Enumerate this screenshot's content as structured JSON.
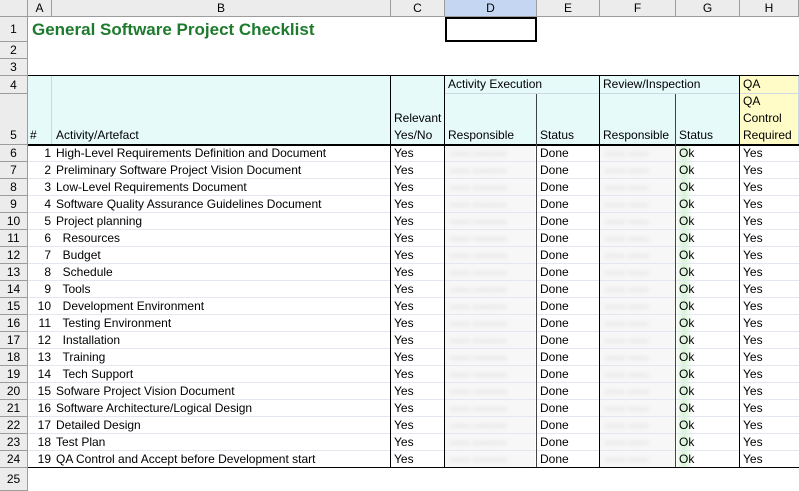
{
  "columns": [
    "A",
    "B",
    "C",
    "D",
    "E",
    "F",
    "G",
    "H"
  ],
  "rows_visible": [
    "1",
    "2",
    "3",
    "4",
    "5",
    "6",
    "7",
    "8",
    "9",
    "10",
    "11",
    "12",
    "13",
    "14",
    "15",
    "16",
    "17",
    "18",
    "19",
    "20",
    "21",
    "22",
    "23",
    "24",
    "25"
  ],
  "title": "General Software Project Checklist",
  "headers": {
    "num": "#",
    "activity": "Activity/Artefact",
    "relevant_line1": "Relevant",
    "relevant_line2": "Yes/No",
    "activity_execution": "Activity Execution",
    "review_inspection": "Review/Inspection",
    "qa": "QA",
    "responsible": "Responsible",
    "status": "Status",
    "qa_line1": "QA",
    "qa_line2": "Control",
    "qa_line3": "Required"
  },
  "items": [
    {
      "row": "6",
      "num": "1",
      "activity": "High-Level Requirements Definition and Document",
      "relevant": "Yes",
      "status": "Done",
      "rev_status": "Ok",
      "qa": "Yes"
    },
    {
      "row": "7",
      "num": "2",
      "activity": "Preliminary Software Project Vision Document",
      "relevant": "Yes",
      "status": "Done",
      "rev_status": "Ok",
      "qa": "Yes"
    },
    {
      "row": "8",
      "num": "3",
      "activity": "Low-Level Requirements Document",
      "relevant": "Yes",
      "status": "Done",
      "rev_status": "Ok",
      "qa": "Yes"
    },
    {
      "row": "9",
      "num": "4",
      "activity": "Software Quality Assurance Guidelines Document",
      "relevant": "Yes",
      "status": "Done",
      "rev_status": "Ok",
      "qa": "Yes"
    },
    {
      "row": "10",
      "num": "5",
      "activity": "Project planning",
      "relevant": "Yes",
      "status": "Done",
      "rev_status": "Ok",
      "qa": "Yes"
    },
    {
      "row": "11",
      "num": "6",
      "activity": "  Resources",
      "relevant": "Yes",
      "status": "Done",
      "rev_status": "Ok",
      "qa": "Yes"
    },
    {
      "row": "12",
      "num": "7",
      "activity": "  Budget",
      "relevant": "Yes",
      "status": "Done",
      "rev_status": "Ok",
      "qa": "Yes"
    },
    {
      "row": "13",
      "num": "8",
      "activity": "  Schedule",
      "relevant": "Yes",
      "status": "Done",
      "rev_status": "Ok",
      "qa": "Yes"
    },
    {
      "row": "14",
      "num": "9",
      "activity": "  Tools",
      "relevant": "Yes",
      "status": "Done",
      "rev_status": "Ok",
      "qa": "Yes"
    },
    {
      "row": "15",
      "num": "10",
      "activity": "  Development Environment",
      "relevant": "Yes",
      "status": "Done",
      "rev_status": "Ok",
      "qa": "Yes"
    },
    {
      "row": "16",
      "num": "11",
      "activity": "  Testing Environment",
      "relevant": "Yes",
      "status": "Done",
      "rev_status": "Ok",
      "qa": "Yes"
    },
    {
      "row": "17",
      "num": "12",
      "activity": "  Installation",
      "relevant": "Yes",
      "status": "Done",
      "rev_status": "Ok",
      "qa": "Yes"
    },
    {
      "row": "18",
      "num": "13",
      "activity": "  Training",
      "relevant": "Yes",
      "status": "Done",
      "rev_status": "Ok",
      "qa": "Yes"
    },
    {
      "row": "19",
      "num": "14",
      "activity": "  Tech Support",
      "relevant": "Yes",
      "status": "Done",
      "rev_status": "Ok",
      "qa": "Yes"
    },
    {
      "row": "20",
      "num": "15",
      "activity": "Sofware Project Vision Document",
      "relevant": "Yes",
      "status": "Done",
      "rev_status": "Ok",
      "qa": "Yes"
    },
    {
      "row": "21",
      "num": "16",
      "activity": "Software Architecture/Logical Design",
      "relevant": "Yes",
      "status": "Done",
      "rev_status": "Ok",
      "qa": "Yes"
    },
    {
      "row": "22",
      "num": "17",
      "activity": "Detailed Design",
      "relevant": "Yes",
      "status": "Done",
      "rev_status": "Ok",
      "qa": "Yes"
    },
    {
      "row": "23",
      "num": "18",
      "activity": "Test Plan",
      "relevant": "Yes",
      "status": "Done",
      "rev_status": "Ok",
      "qa": "Yes"
    },
    {
      "row": "24",
      "num": "19",
      "activity": "QA Control and Accept before Development start",
      "relevant": "Yes",
      "status": "Done",
      "rev_status": "Ok",
      "qa": "Yes"
    }
  ],
  "colors": {
    "title_green": "#1e7b2e",
    "header_cyan": "#e6fafa",
    "qa_yellow": "#fffcc8",
    "selected_col_header": "#c4d6f2"
  }
}
